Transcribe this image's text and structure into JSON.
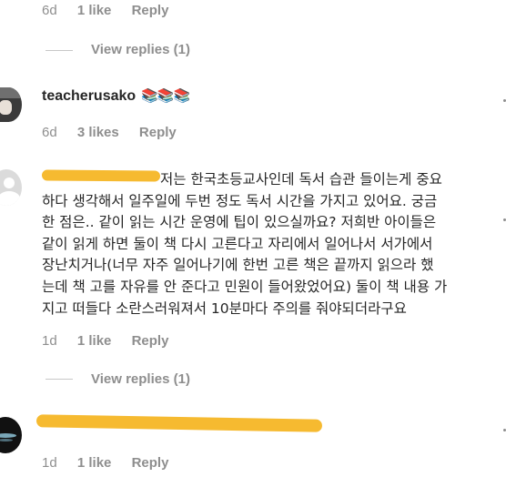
{
  "comment0": {
    "time": "6d",
    "likes": "1 like",
    "reply": "Reply"
  },
  "replies1": {
    "label": "View replies (1)"
  },
  "comment1": {
    "username": "teacherusako",
    "emoji": "📚📚📚",
    "time": "6d",
    "likes": "3 likes",
    "reply": "Reply"
  },
  "comment2": {
    "text": "저는 한국초등교사인데 독서 습관 들이는게 중요\n하다 생각해서 일주일에 두번 정도 독서 시간을 가지고 있어요. 궁금\n한 점은.. 같이 읽는 시간 운영에 팁이 있으실까요? 저희반 아이들은\n같이 읽게 하면 둘이 책 다시 고른다고 자리에서 일어나서 서가에서\n장난치거나(너무 자주 일어나기에 한번 고른 책은 끝까지 읽으라 했\n는데 책 고를 자유를 안 준다고 민원이 들어왔었어요) 둘이 책 내용 가\n지고 떠들다 소란스러워져서 10분마다 주의를 줘야되더라구요",
    "time": "1d",
    "likes": "1 like",
    "reply": "Reply"
  },
  "replies2": {
    "label": "View replies (1)"
  },
  "comment3": {
    "time": "1d",
    "likes": "1 like",
    "reply": "Reply"
  },
  "colors": {
    "text": "#262626",
    "muted": "#8e8e8e",
    "redaction": "#f5b319"
  }
}
